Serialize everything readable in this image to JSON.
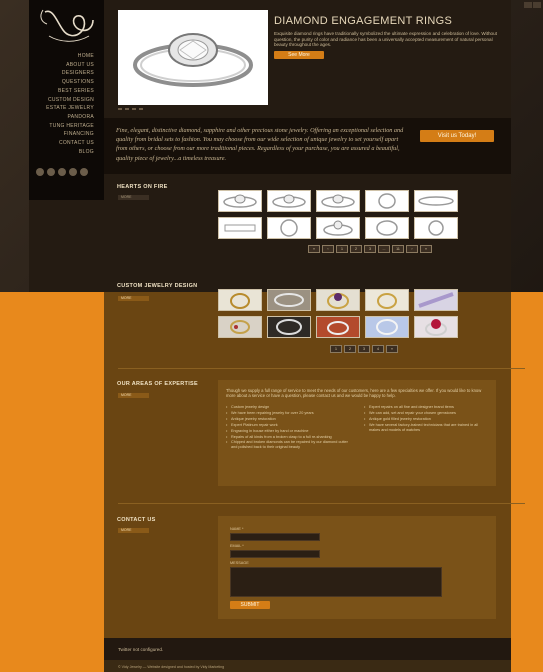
{
  "utility_icons": [
    "fb-icon",
    "tw-icon"
  ],
  "sidebar": {
    "logo_text": "Vidy",
    "nav": [
      "HOME",
      "ABOUT US",
      "DESIGNERS",
      "QUESTIONS",
      "BEST SERIES",
      "CUSTOM DESIGN",
      "ESTATE JEWELRY",
      "PANDORA",
      "TUNG HERITAGE",
      "FINANCING",
      "CONTACT US",
      "BLOG"
    ]
  },
  "hero": {
    "title": "DIAMOND ENGAGEMENT RINGS",
    "text": "Exquisite diamond rings have traditionally symbolized the ultimate expression and celebration of love. Without question, the purity of color and radiance has been a universally accepted measurement of natural personal beauty throughout the ages.",
    "button": "See More"
  },
  "intro": {
    "text": "Fine, elegant, distinctive diamond, sapphire and other precious stone jewelry. Offering an exceptional selection and quality from bridal sets to fashion. You may choose from our wide selection of unique jewelry to set yourself apart from others, or choose from our more traditional pieces. Regardless of your purchase, you are assured a beautiful, quality piece of jewelry...a timeless treasure.",
    "button": "Visit us Today!"
  },
  "hearts_on_fire": {
    "title": "HEARTS ON FIRE",
    "more": "MORE",
    "pager": [
      "«",
      "‹",
      "1",
      "2",
      "3",
      "...",
      "11",
      "›",
      "»"
    ]
  },
  "custom_design": {
    "title": "CUSTOM JEWELRY DESIGN",
    "more": "MORE",
    "pager": [
      "1",
      "2",
      "3",
      "4",
      "»"
    ]
  },
  "expertise": {
    "title": "OUR AREAS OF EXPERTISE",
    "more": "MORE",
    "intro": "Though we supply a full range of service to meet the needs of our customers, here are a few specialties we offer. If you would like to know more about a service or have a question, please contact us and we would be happy to help.",
    "col1": [
      "Custom jewelry design",
      "We have been repairing jewelry for over 20 years",
      "Antique jewelry restoration",
      "Expert Platinum repair work",
      "Engraving in house either by hand or machine",
      "Repairs of all kinds from a broken clasp to a full re-shanking",
      "Chipped and broken diamonds can be repaired by our diamond cutter and polished back to their original beauty"
    ],
    "col2": [
      "Expert repairs on all fine and designer brand items",
      "We can add, set and repair your chosen gemstones",
      "Antique gold filled jewelry restoration",
      "We have several factory-trained technicians that are trained in all makes and models of watches"
    ]
  },
  "contact": {
    "title": "CONTACT US",
    "more": "MORE",
    "name_label": "NAME *",
    "email_label": "EMAIL *",
    "message_label": "MESSAGE",
    "submit": "SUBMIT"
  },
  "footer": {
    "message": "Twitter not configured.",
    "copyright": "© Vidy Jewelry — Website designed and hosted by Vidy Marketing"
  },
  "colors": {
    "accent": "#d47d16",
    "background_orange": "#e8891c",
    "panel_brown": "#6a4512",
    "dark": "#160f09"
  }
}
